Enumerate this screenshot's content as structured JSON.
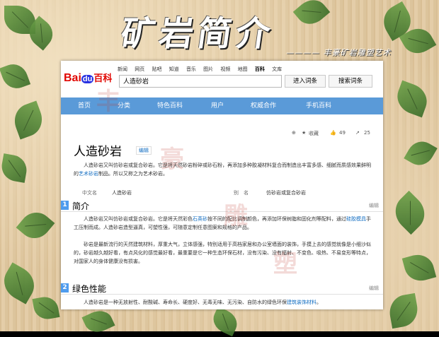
{
  "banner": {
    "title": "矿岩简介",
    "subtitle": "———— 丰豪矿岩雕塑艺术"
  },
  "topnav": [
    "新闻",
    "网页",
    "贴吧",
    "知道",
    "音乐",
    "图片",
    "视频",
    "地图",
    "百科",
    "文库"
  ],
  "topnav_active": "百科",
  "logo": {
    "bai": "Bai",
    "du": "du",
    "baike": "百科"
  },
  "search": {
    "value": "人造砂岩",
    "enter_button": "进入词条",
    "search_button": "搜索词条"
  },
  "mainnav": [
    "首页",
    "分类",
    "特色百科",
    "用户",
    "权威合作",
    "手机百科"
  ],
  "tools": {
    "collect": "收藏",
    "likes": "49",
    "shares": "25"
  },
  "article": {
    "title": "人造砂岩",
    "edit": "编辑",
    "summary_parts": [
      "人造砂岩又叫仿砂岩或复合砂岩。它是将天然砂岩粉碎或砂石粉，再添加多种胶凝材料复合而制造出丰富多感、细腻而质感效果鲜明的",
      "艺术砂岩",
      "制品。所以又称之为艺术砂岩。"
    ],
    "info": {
      "cn_name_key": "中文名",
      "cn_name_val": "人造砂岩",
      "alias_key": "别　名",
      "alias_val": "仿砂岩或复合砂岩"
    }
  },
  "sections": [
    {
      "num": "1",
      "title": "简介",
      "edit": "编辑"
    },
    {
      "num": "2",
      "title": "绿色性能",
      "edit": "编辑"
    }
  ],
  "intro_p1_parts": [
    "人造砂岩又叫仿砂岩或复合砂岩。它是将天然彩色",
    "石英砂",
    "按不同的配比调制颜色，再添加环保树脂和固化剂等配料，通过",
    "硅胶模具",
    "手工压制而成。人造砂岩造型逼真，可塑性强，可随意定制任意图案和规格的产品。"
  ],
  "intro_p2": "砂岩是最新流行的天然建筑材料，厚重大气，立体感强，特别适用于高档家居和办公室墙面的装饰，手摸上去的感觉就像是小细沙似的，砂岩越久越好看，有点风化的感觉最好看，最重要是它一种生态环保石材，没有污染、没有辐射、不变色、吸热、不易变形等特点，对国家人的身体健康没有损害。",
  "green_parts": [
    "人造砂岩是一种无放射性、耐酸碱、寿命长、硬度好、无毒无味、无污染、自防水的绿色环保",
    "建筑装饰材料",
    "。"
  ],
  "watermark": [
    "丰",
    "豪",
    "雕",
    "塑"
  ],
  "colors": {
    "accent_blue": "#5a9ad8",
    "link": "#136ec2",
    "baidu_red": "#e10601",
    "baidu_blue": "#2932e1"
  }
}
